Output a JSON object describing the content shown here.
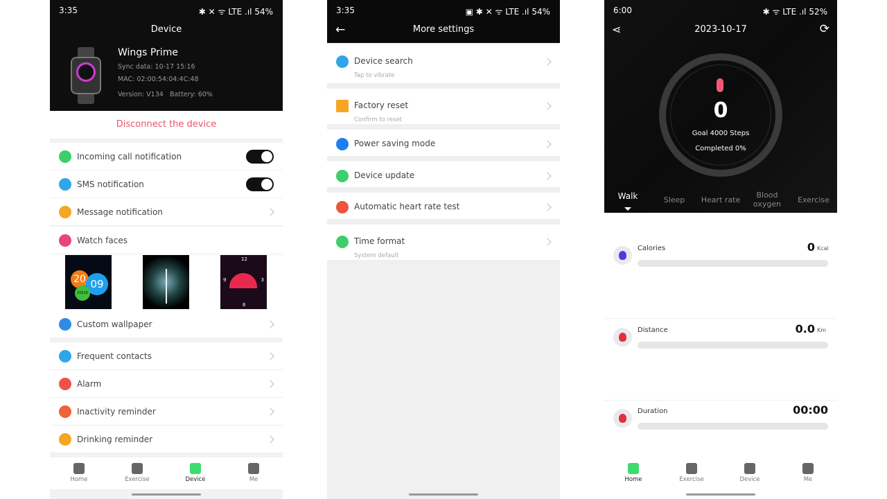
{
  "device_screen": {
    "status": {
      "time": "3:35",
      "icons": "✱ ✕ ᯤ LTE .ıl",
      "battery": "54%"
    },
    "title": "Device",
    "name": "Wings Prime",
    "sync": "Sync data: 10-17 15:16",
    "mac": "MAC: 02:00:54:04:4C:48",
    "version": "Version: V134",
    "battery": "Battery: 60%",
    "disconnect": "Disconnect the device",
    "rows": [
      {
        "label": "Incoming call notification",
        "icon": "phone-icon",
        "color": "#3ccf6a",
        "control": "toggle",
        "on": true
      },
      {
        "label": "SMS notification",
        "icon": "chat-icon",
        "color": "#2fa6e8",
        "control": "toggle",
        "on": true
      },
      {
        "label": "Message notification",
        "icon": "speaker-icon",
        "color": "#f5a623",
        "control": "chevron"
      },
      {
        "label": "Watch faces",
        "icon": "watch-icon",
        "color": "#e8457a",
        "control": "none"
      },
      {
        "label": "Custom wallpaper",
        "icon": "grid-icon",
        "color": "#2f8be8",
        "control": "chevron"
      },
      {
        "label": "Frequent contacts",
        "icon": "contacts-icon",
        "color": "#2fa6e8",
        "control": "chevron"
      },
      {
        "label": "Alarm",
        "icon": "bell-icon",
        "color": "#f0524a",
        "control": "chevron"
      },
      {
        "label": "Inactivity reminder",
        "icon": "clock-icon",
        "color": "#f0623a",
        "control": "chevron"
      },
      {
        "label": "Drinking reminder",
        "icon": "cup-icon",
        "color": "#f5a623",
        "control": "chevron"
      }
    ],
    "watch_faces": [
      {
        "a": "20",
        "b": "09",
        "c": "20826"
      },
      {},
      {
        "n12": "12",
        "n3": "3",
        "n6": "6",
        "n9": "9"
      }
    ]
  },
  "settings_screen": {
    "status": {
      "time": "3:35",
      "icons": "▣ ✱ ✕ ᯤ LTE .ıl",
      "battery": "54%"
    },
    "title": "More settings",
    "rows": [
      {
        "label": "Device search",
        "sub": "Tap to vibrate",
        "icon": "device-search-icon",
        "color": "#2fa6e8"
      },
      {
        "label": "Factory reset",
        "sub": "Confirm to reset",
        "icon": "reset-icon",
        "color": "#f5a623"
      },
      {
        "label": "Power saving mode",
        "icon": "battery-icon",
        "color": "#1e7ef0"
      },
      {
        "label": "Device update",
        "icon": "upload-icon",
        "color": "#3ccf6a"
      },
      {
        "label": "Automatic heart rate test",
        "icon": "heart-icon",
        "color": "#f0523a"
      },
      {
        "label": "Time format",
        "sub": "System default",
        "icon": "clock-icon",
        "color": "#3ccf6a"
      }
    ]
  },
  "home_screen": {
    "status": {
      "time": "6:00",
      "icons": "✱ ᯤ LTE .ıl",
      "battery": "52%"
    },
    "date": "2023-10-17",
    "steps": "0",
    "goal": "Goal 4000 Steps",
    "completed": "Completed 0%",
    "progress_percent": 0,
    "tabs": [
      "Walk",
      "Sleep",
      "Heart rate",
      "Blood oxygen",
      "Exercise"
    ],
    "active_tab": "Walk",
    "metrics": [
      {
        "name": "Calories",
        "value": "0",
        "unit": "Kcal",
        "color": "#4a3de0",
        "progress": 0
      },
      {
        "name": "Distance",
        "value": "0.0",
        "unit": "Km",
        "color": "#e0303a",
        "progress": 0
      },
      {
        "name": "Duration",
        "value": "00:00",
        "unit": "",
        "color": "#e0303a",
        "progress": 0
      }
    ]
  },
  "nav": {
    "items": [
      "Home",
      "Exercise",
      "Device",
      "Me"
    ]
  }
}
